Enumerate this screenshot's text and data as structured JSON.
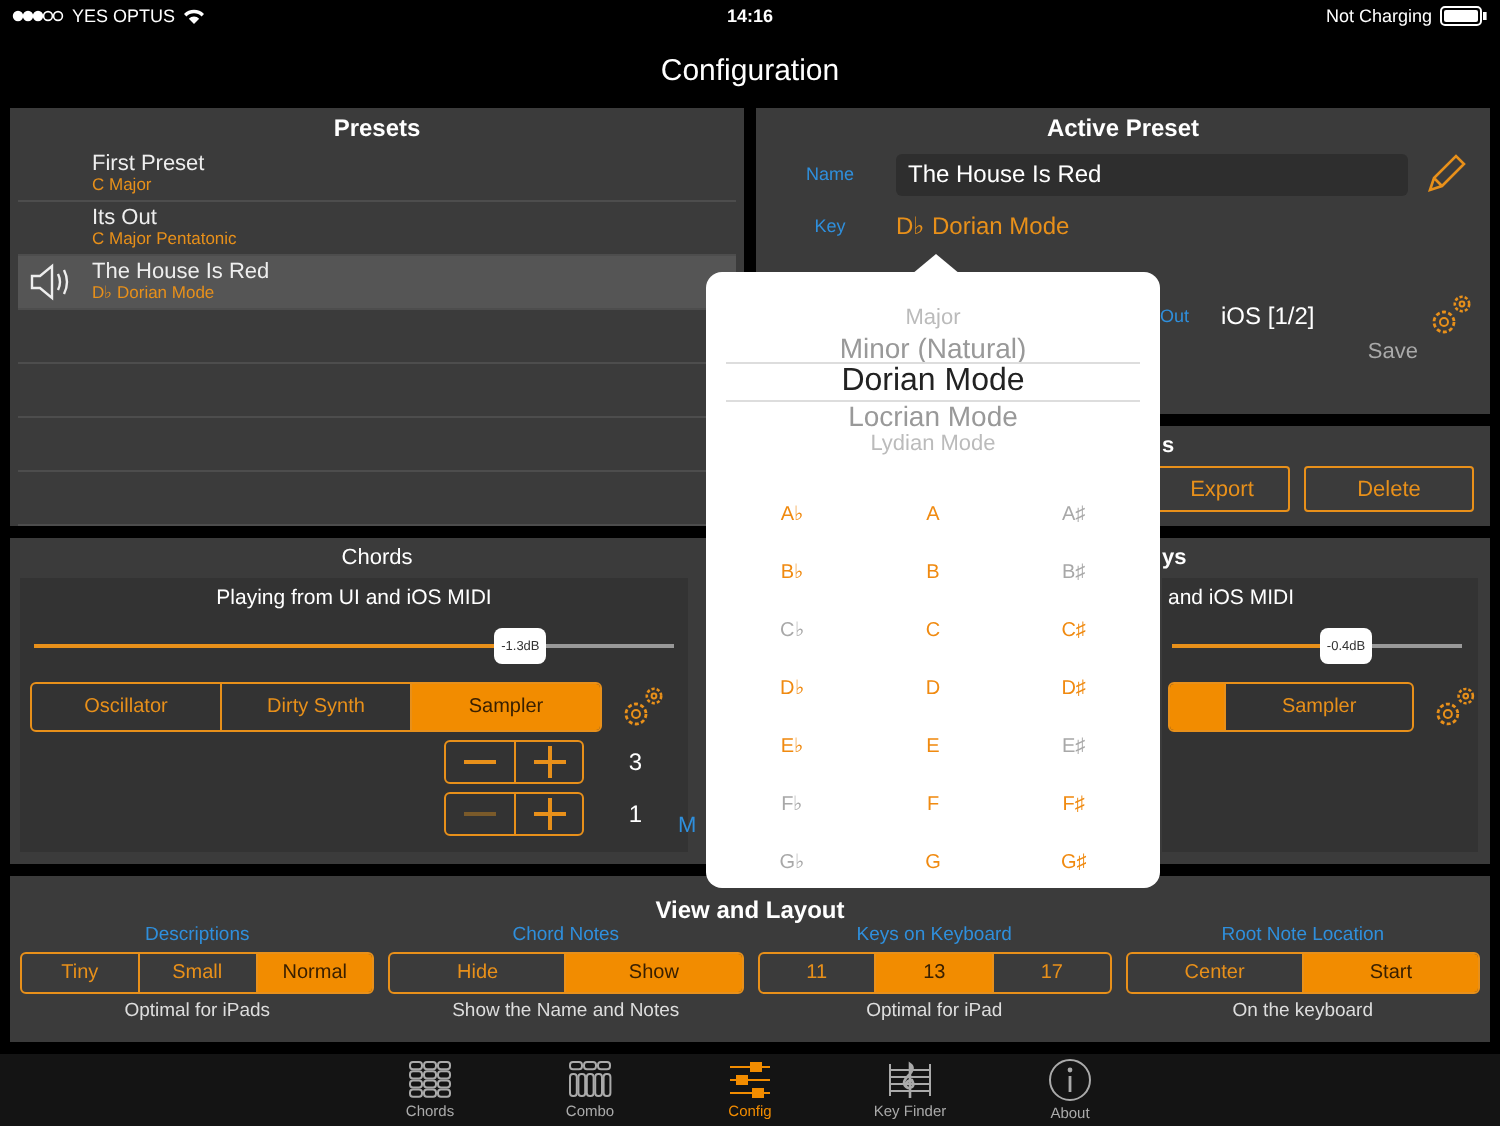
{
  "status_bar": {
    "carrier": "YES OPTUS",
    "time": "14:16",
    "battery": "Not Charging"
  },
  "title": "Configuration",
  "presets": {
    "title": "Presets",
    "items": [
      {
        "name": "First Preset",
        "key": "C Major",
        "selected": false
      },
      {
        "name": "Its Out",
        "key": "C Major Pentatonic",
        "selected": false
      },
      {
        "name": "The House Is Red",
        "key": "D♭ Dorian Mode",
        "selected": true
      }
    ]
  },
  "active_preset": {
    "title": "Active Preset",
    "name_label": "Name",
    "name_value": "The House Is Red",
    "key_label": "Key",
    "key_value": "D♭ Dorian Mode",
    "out_label": "Out",
    "out_value": "iOS [1/2]",
    "save": "Save"
  },
  "preset_actions": {
    "title_fragment": "s",
    "buttons": [
      "Export",
      "Delete"
    ]
  },
  "chords": {
    "title": "Chords",
    "source": "Playing from UI and iOS MIDI",
    "volume": {
      "level": 0.76,
      "reading": "-1.3dB"
    },
    "instruments": [
      {
        "label": "Oscillator",
        "selected": false
      },
      {
        "label": "Dirty Synth",
        "selected": false
      },
      {
        "label": "Sampler",
        "selected": true
      }
    ],
    "steppers": [
      {
        "value": "3",
        "minus_disabled": false
      },
      {
        "value": "1",
        "minus_disabled": true
      }
    ],
    "side_label": "M"
  },
  "keys_panel": {
    "title_fragment": "ys",
    "source_fragment": "and iOS MIDI",
    "volume": {
      "level": 0.6,
      "reading": "-0.4dB"
    },
    "instruments": [
      {
        "selected": true
      },
      {
        "label": "Sampler",
        "selected": false
      }
    ]
  },
  "layout": {
    "title": "View and Layout",
    "groups": [
      {
        "label": "Descriptions",
        "options": [
          {
            "label": "Tiny",
            "selected": false
          },
          {
            "label": "Small",
            "selected": false
          },
          {
            "label": "Normal",
            "selected": true
          }
        ],
        "note": "Optimal for iPads"
      },
      {
        "label": "Chord Notes",
        "options": [
          {
            "label": "Hide",
            "selected": false
          },
          {
            "label": "Show",
            "selected": true
          }
        ],
        "note": "Show the Name and Notes"
      },
      {
        "label": "Keys on Keyboard",
        "options": [
          {
            "label": "11",
            "selected": false
          },
          {
            "label": "13",
            "selected": true
          },
          {
            "label": "17",
            "selected": false
          }
        ],
        "note": "Optimal for iPad"
      },
      {
        "label": "Root Note Location",
        "options": [
          {
            "label": "Center",
            "selected": false
          },
          {
            "label": "Start",
            "selected": true
          }
        ],
        "note": "On the keyboard"
      }
    ]
  },
  "key_picker": {
    "modes": [
      {
        "label": "Major",
        "selected": false
      },
      {
        "label": "Minor (Natural)",
        "selected": false
      },
      {
        "label": "Dorian Mode",
        "selected": true
      },
      {
        "label": "Locrian Mode",
        "selected": false
      },
      {
        "label": "Lydian Mode",
        "selected": false
      }
    ],
    "notes": [
      {
        "label": "A♭",
        "enabled": true
      },
      {
        "label": "A",
        "enabled": true
      },
      {
        "label": "A♯",
        "enabled": false
      },
      {
        "label": "B♭",
        "enabled": true
      },
      {
        "label": "B",
        "enabled": true
      },
      {
        "label": "B♯",
        "enabled": false
      },
      {
        "label": "C♭",
        "enabled": false
      },
      {
        "label": "C",
        "enabled": true
      },
      {
        "label": "C♯",
        "enabled": true
      },
      {
        "label": "D♭",
        "enabled": true
      },
      {
        "label": "D",
        "enabled": true
      },
      {
        "label": "D♯",
        "enabled": true
      },
      {
        "label": "E♭",
        "enabled": true
      },
      {
        "label": "E",
        "enabled": true
      },
      {
        "label": "E♯",
        "enabled": false
      },
      {
        "label": "F♭",
        "enabled": false
      },
      {
        "label": "F",
        "enabled": true
      },
      {
        "label": "F♯",
        "enabled": true
      },
      {
        "label": "G♭",
        "enabled": false
      },
      {
        "label": "G",
        "enabled": true
      },
      {
        "label": "G♯",
        "enabled": true
      }
    ]
  },
  "tabs": [
    {
      "label": "Chords",
      "selected": false
    },
    {
      "label": "Combo",
      "selected": false
    },
    {
      "label": "Config",
      "selected": true
    },
    {
      "label": "Key Finder",
      "selected": false
    },
    {
      "label": "About",
      "selected": false
    }
  ]
}
